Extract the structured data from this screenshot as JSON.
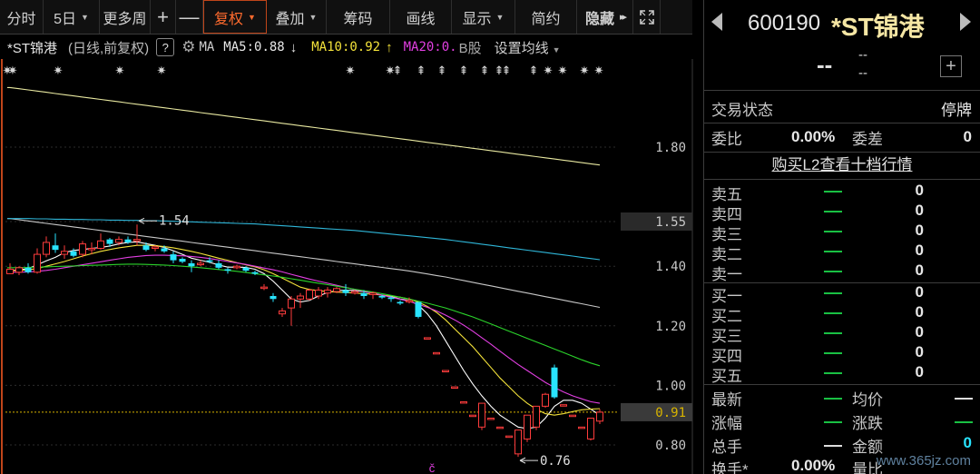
{
  "toolbar": {
    "items": [
      {
        "label": "分时",
        "caret": false
      },
      {
        "label": "5日",
        "caret": true
      },
      {
        "label": "更多周",
        "caret": false
      },
      {
        "label": "+",
        "caret": false
      },
      {
        "label": "—",
        "caret": false
      },
      {
        "label": "复权",
        "caret": true,
        "active": true
      },
      {
        "label": "叠加",
        "caret": true
      },
      {
        "label": "筹码",
        "caret": false
      },
      {
        "label": "画线",
        "caret": false
      },
      {
        "label": "显示",
        "caret": true
      },
      {
        "label": "简约",
        "caret": false
      },
      {
        "label": "隐藏",
        "caret": false
      }
    ],
    "hide_arrows": "▸▸",
    "expand_icon": "expand-icon"
  },
  "ma_line": {
    "stock_name": "*ST锦港",
    "sub": "(日线,前复权)",
    "help": "?",
    "ma_label": "MA",
    "ma5": "MA5:0.88",
    "ma5_arrow": "↓",
    "ma10": "MA10:0.92",
    "ma10_arrow": "↑",
    "ma20": "MA20:0.",
    "b_share": "B股",
    "set_ma": "设置均线"
  },
  "chart_data": {
    "type": "candlestick",
    "y_tick_labels": [
      "1.80",
      "1.55",
      "1.40",
      "1.20",
      "1.00",
      "0.91",
      "0.80"
    ],
    "y_ticks": [
      1.8,
      1.55,
      1.4,
      1.2,
      1.0,
      0.91,
      0.8
    ],
    "current_price_label": "0.91",
    "high_marker": "1.54",
    "low_marker": "0.76",
    "colors": {
      "up": "#ff3c3c",
      "down": "#29e4ff",
      "ma5": "#ffffff",
      "ma10": "#f3e23a",
      "ma20": "#e23fe2",
      "ma30": "#2bd42b",
      "ma60": "#c8c8c8",
      "ma120": "#2fb6d8",
      "ma250": "#e8e8a0",
      "price_line": "#d8b400"
    },
    "candles": [
      {
        "o": 1.375,
        "c": 1.39,
        "h": 1.41,
        "l": 1.375
      },
      {
        "o": 1.38,
        "c": 1.395,
        "h": 1.4,
        "l": 1.37
      },
      {
        "o": 1.395,
        "c": 1.38,
        "h": 1.41,
        "l": 1.375
      },
      {
        "o": 1.38,
        "c": 1.44,
        "h": 1.46,
        "l": 1.375
      },
      {
        "o": 1.44,
        "c": 1.48,
        "h": 1.5,
        "l": 1.43
      },
      {
        "o": 1.47,
        "c": 1.455,
        "h": 1.51,
        "l": 1.445
      },
      {
        "o": 1.44,
        "c": 1.45,
        "h": 1.47,
        "l": 1.425
      },
      {
        "o": 1.45,
        "c": 1.435,
        "h": 1.46,
        "l": 1.43
      },
      {
        "o": 1.44,
        "c": 1.475,
        "h": 1.485,
        "l": 1.43
      },
      {
        "o": 1.46,
        "c": 1.46,
        "h": 1.48,
        "l": 1.44
      },
      {
        "o": 1.46,
        "c": 1.485,
        "h": 1.51,
        "l": 1.455
      },
      {
        "o": 1.49,
        "c": 1.475,
        "h": 1.495,
        "l": 1.465
      },
      {
        "o": 1.48,
        "c": 1.49,
        "h": 1.5,
        "l": 1.47
      },
      {
        "o": 1.49,
        "c": 1.48,
        "h": 1.5,
        "l": 1.475
      },
      {
        "o": 1.485,
        "c": 1.49,
        "h": 1.54,
        "l": 1.47
      },
      {
        "o": 1.47,
        "c": 1.455,
        "h": 1.48,
        "l": 1.45
      },
      {
        "o": 1.46,
        "c": 1.465,
        "h": 1.47,
        "l": 1.45
      },
      {
        "o": 1.46,
        "c": 1.45,
        "h": 1.47,
        "l": 1.445
      },
      {
        "o": 1.44,
        "c": 1.42,
        "h": 1.45,
        "l": 1.41
      },
      {
        "o": 1.425,
        "c": 1.415,
        "h": 1.43,
        "l": 1.41
      },
      {
        "o": 1.41,
        "c": 1.4,
        "h": 1.42,
        "l": 1.38
      },
      {
        "o": 1.405,
        "c": 1.41,
        "h": 1.42,
        "l": 1.4
      },
      {
        "o": 1.42,
        "c": 1.415,
        "h": 1.43,
        "l": 1.41
      },
      {
        "o": 1.41,
        "c": 1.395,
        "h": 1.42,
        "l": 1.39
      },
      {
        "o": 1.39,
        "c": 1.385,
        "h": 1.395,
        "l": 1.375
      },
      {
        "o": 1.395,
        "c": 1.4,
        "h": 1.405,
        "l": 1.39
      },
      {
        "o": 1.395,
        "c": 1.385,
        "h": 1.4,
        "l": 1.38
      },
      {
        "o": 1.38,
        "c": 1.375,
        "h": 1.385,
        "l": 1.37
      },
      {
        "o": 1.33,
        "c": 1.33,
        "h": 1.34,
        "l": 1.32
      },
      {
        "o": 1.3,
        "c": 1.29,
        "h": 1.31,
        "l": 1.28
      },
      {
        "o": 1.24,
        "c": 1.25,
        "h": 1.26,
        "l": 1.23
      },
      {
        "o": 1.26,
        "c": 1.29,
        "h": 1.3,
        "l": 1.2
      },
      {
        "o": 1.29,
        "c": 1.3,
        "h": 1.31,
        "l": 1.26
      },
      {
        "o": 1.29,
        "c": 1.32,
        "h": 1.325,
        "l": 1.285
      },
      {
        "o": 1.3,
        "c": 1.32,
        "h": 1.33,
        "l": 1.29
      },
      {
        "o": 1.31,
        "c": 1.32,
        "h": 1.33,
        "l": 1.295
      },
      {
        "o": 1.315,
        "c": 1.325,
        "h": 1.33,
        "l": 1.31
      },
      {
        "o": 1.32,
        "c": 1.31,
        "h": 1.34,
        "l": 1.3
      },
      {
        "o": 1.31,
        "c": 1.315,
        "h": 1.32,
        "l": 1.305
      },
      {
        "o": 1.31,
        "c": 1.3,
        "h": 1.32,
        "l": 1.29
      },
      {
        "o": 1.305,
        "c": 1.31,
        "h": 1.315,
        "l": 1.29
      },
      {
        "o": 1.3,
        "c": 1.295,
        "h": 1.305,
        "l": 1.29
      },
      {
        "o": 1.295,
        "c": 1.29,
        "h": 1.3,
        "l": 1.28
      },
      {
        "o": 1.28,
        "c": 1.275,
        "h": 1.285,
        "l": 1.27
      },
      {
        "o": 1.285,
        "c": 1.285,
        "h": 1.295,
        "l": 1.275
      },
      {
        "o": 1.28,
        "c": 1.23,
        "h": 1.28,
        "l": 1.225
      },
      {
        "o": 1.16,
        "c": 1.16,
        "h": 1.16,
        "l": 1.16
      },
      {
        "o": 1.11,
        "c": 1.11,
        "h": 1.11,
        "l": 1.11
      },
      {
        "o": 1.05,
        "c": 1.05,
        "h": 1.05,
        "l": 1.05
      },
      {
        "o": 0.995,
        "c": 0.995,
        "h": 0.995,
        "l": 0.995
      },
      {
        "o": 0.945,
        "c": 0.945,
        "h": 0.945,
        "l": 0.945
      },
      {
        "o": 0.9,
        "c": 0.9,
        "h": 0.9,
        "l": 0.9
      },
      {
        "o": 0.86,
        "c": 0.94,
        "h": 0.94,
        "l": 0.85
      },
      {
        "o": 0.89,
        "c": 0.89,
        "h": 0.89,
        "l": 0.89
      },
      {
        "o": 0.86,
        "c": 0.86,
        "h": 0.86,
        "l": 0.86
      },
      {
        "o": 0.83,
        "c": 0.83,
        "h": 0.83,
        "l": 0.83
      },
      {
        "o": 0.77,
        "c": 0.85,
        "h": 0.85,
        "l": 0.76
      },
      {
        "o": 0.82,
        "c": 0.9,
        "h": 0.9,
        "l": 0.81
      },
      {
        "o": 0.86,
        "c": 0.93,
        "h": 0.93,
        "l": 0.85
      },
      {
        "o": 0.93,
        "c": 0.97,
        "h": 0.975,
        "l": 0.925
      },
      {
        "o": 1.06,
        "c": 0.96,
        "h": 1.07,
        "l": 0.955
      },
      {
        "o": 0.935,
        "c": 0.935,
        "h": 0.935,
        "l": 0.935
      },
      {
        "o": 0.9,
        "c": 0.9,
        "h": 0.9,
        "l": 0.9
      },
      {
        "o": 0.86,
        "c": 0.86,
        "h": 0.86,
        "l": 0.86
      },
      {
        "o": 0.82,
        "c": 0.89,
        "h": 0.89,
        "l": 0.815
      },
      {
        "o": 0.88,
        "c": 0.91,
        "h": 0.92,
        "l": 0.87
      }
    ],
    "ma_lines": {
      "ma5": [
        1.385,
        1.388,
        1.392,
        1.405,
        1.418,
        1.43,
        1.446,
        1.453,
        1.456,
        1.46,
        1.463,
        1.468,
        1.475,
        1.48,
        1.482,
        1.476,
        1.47,
        1.463,
        1.452,
        1.44,
        1.427,
        1.42,
        1.413,
        1.404,
        1.397,
        1.397,
        1.396,
        1.39,
        1.375,
        1.35,
        1.32,
        1.29,
        1.28,
        1.285,
        1.3,
        1.312,
        1.318,
        1.32,
        1.318,
        1.315,
        1.309,
        1.302,
        1.298,
        1.29,
        1.285,
        1.27,
        1.24,
        1.2,
        1.15,
        1.1,
        1.05,
        1.005,
        0.965,
        0.93,
        0.9,
        0.88,
        0.86,
        0.855,
        0.86,
        0.89,
        0.93,
        0.95,
        0.95,
        0.94,
        0.92,
        0.9
      ],
      "ma10": [
        1.385,
        1.386,
        1.388,
        1.392,
        1.4,
        1.408,
        1.416,
        1.425,
        1.434,
        1.442,
        1.45,
        1.456,
        1.462,
        1.466,
        1.47,
        1.47,
        1.469,
        1.466,
        1.462,
        1.456,
        1.45,
        1.443,
        1.435,
        1.427,
        1.42,
        1.412,
        1.405,
        1.398,
        1.388,
        1.375,
        1.36,
        1.345,
        1.33,
        1.322,
        1.318,
        1.315,
        1.313,
        1.312,
        1.31,
        1.308,
        1.306,
        1.303,
        1.3,
        1.296,
        1.29,
        1.28,
        1.265,
        1.245,
        1.22,
        1.19,
        1.16,
        1.13,
        1.095,
        1.06,
        1.025,
        0.995,
        0.965,
        0.94,
        0.92,
        0.905,
        0.9,
        0.905,
        0.912,
        0.918,
        0.92,
        0.922
      ],
      "ma20": [
        1.38,
        1.38,
        1.381,
        1.383,
        1.386,
        1.39,
        1.395,
        1.4,
        1.405,
        1.41,
        1.415,
        1.42,
        1.425,
        1.43,
        1.433,
        1.436,
        1.437,
        1.437,
        1.436,
        1.435,
        1.433,
        1.43,
        1.426,
        1.421,
        1.416,
        1.411,
        1.406,
        1.4,
        1.394,
        1.388,
        1.381,
        1.373,
        1.365,
        1.357,
        1.35,
        1.343,
        1.336,
        1.329,
        1.322,
        1.316,
        1.31,
        1.303,
        1.296,
        1.289,
        1.282,
        1.272,
        1.262,
        1.25,
        1.236,
        1.22,
        1.202,
        1.182,
        1.16,
        1.138,
        1.115,
        1.092,
        1.07,
        1.05,
        1.03,
        1.01,
        0.993,
        0.978,
        0.965,
        0.955,
        0.945,
        0.94
      ],
      "ma30": [
        1.395,
        1.395,
        1.396,
        1.397,
        1.398,
        1.399,
        1.4,
        1.401,
        1.402,
        1.403,
        1.404,
        1.405,
        1.406,
        1.407,
        1.407,
        1.406,
        1.405,
        1.404,
        1.402,
        1.4,
        1.398,
        1.395,
        1.392,
        1.389,
        1.386,
        1.383,
        1.379,
        1.375,
        1.371,
        1.367,
        1.363,
        1.358,
        1.353,
        1.348,
        1.343,
        1.338,
        1.333,
        1.328,
        1.323,
        1.318,
        1.313,
        1.308,
        1.302,
        1.296,
        1.29,
        1.283,
        1.276,
        1.268,
        1.26,
        1.25,
        1.24,
        1.23,
        1.218,
        1.206,
        1.194,
        1.182,
        1.17,
        1.158,
        1.146,
        1.134,
        1.122,
        1.11,
        1.098,
        1.086,
        1.075,
        1.066
      ],
      "ma60": [
        1.56,
        1.556,
        1.552,
        1.548,
        1.544,
        1.54,
        1.536,
        1.532,
        1.528,
        1.524,
        1.52,
        1.516,
        1.512,
        1.508,
        1.504,
        1.5,
        1.496,
        1.492,
        1.488,
        1.484,
        1.48,
        1.476,
        1.472,
        1.468,
        1.464,
        1.46,
        1.456,
        1.452,
        1.448,
        1.444,
        1.44,
        1.436,
        1.432,
        1.428,
        1.424,
        1.42,
        1.416,
        1.412,
        1.408,
        1.404,
        1.4,
        1.396,
        1.392,
        1.388,
        1.384,
        1.379,
        1.374,
        1.369,
        1.364,
        1.358,
        1.352,
        1.346,
        1.34,
        1.334,
        1.328,
        1.322,
        1.316,
        1.31,
        1.304,
        1.298,
        1.292,
        1.286,
        1.28,
        1.274,
        1.268,
        1.262
      ],
      "ma120": [
        1.56,
        1.56,
        1.56,
        1.559,
        1.559,
        1.558,
        1.558,
        1.557,
        1.557,
        1.556,
        1.556,
        1.555,
        1.555,
        1.554,
        1.554,
        1.553,
        1.553,
        1.552,
        1.551,
        1.55,
        1.549,
        1.548,
        1.547,
        1.546,
        1.545,
        1.544,
        1.543,
        1.542,
        1.54,
        1.538,
        1.536,
        1.534,
        1.532,
        1.53,
        1.528,
        1.526,
        1.524,
        1.522,
        1.52,
        1.517,
        1.514,
        1.511,
        1.508,
        1.505,
        1.502,
        1.499,
        1.496,
        1.493,
        1.49,
        1.486,
        1.482,
        1.478,
        1.474,
        1.47,
        1.466,
        1.462,
        1.458,
        1.454,
        1.45,
        1.446,
        1.442,
        1.438,
        1.434,
        1.43,
        1.426,
        1.422
      ],
      "ma250": [
        2.0,
        1.996,
        1.992,
        1.988,
        1.984,
        1.98,
        1.976,
        1.972,
        1.968,
        1.964,
        1.96,
        1.956,
        1.952,
        1.948,
        1.944,
        1.94,
        1.936,
        1.932,
        1.928,
        1.924,
        1.92,
        1.916,
        1.912,
        1.908,
        1.904,
        1.9,
        1.896,
        1.892,
        1.888,
        1.884,
        1.88,
        1.876,
        1.872,
        1.868,
        1.864,
        1.86,
        1.856,
        1.852,
        1.848,
        1.844,
        1.84,
        1.836,
        1.832,
        1.828,
        1.824,
        1.82,
        1.816,
        1.812,
        1.808,
        1.804,
        1.8,
        1.796,
        1.792,
        1.788,
        1.784,
        1.78,
        1.776,
        1.772,
        1.768,
        1.764,
        1.76,
        1.756,
        1.752,
        1.748,
        1.744,
        1.74
      ]
    },
    "current_price": 0.91
  },
  "panel": {
    "code": "600190",
    "name": "*ST锦港",
    "price": "--",
    "change": "--",
    "change_pct": "--",
    "plus": "+",
    "status_label": "交易状态",
    "status_value": "停牌",
    "weibi_label": "委比",
    "weibi_value": "0.00%",
    "weicha_label": "委差",
    "weicha_value": "0",
    "l2_link": "购买L2查看十档行情",
    "sell": [
      {
        "label": "卖五",
        "vol": "0"
      },
      {
        "label": "卖四",
        "vol": "0"
      },
      {
        "label": "卖三",
        "vol": "0"
      },
      {
        "label": "卖二",
        "vol": "0"
      },
      {
        "label": "卖一",
        "vol": "0"
      }
    ],
    "buy": [
      {
        "label": "买一",
        "vol": "0"
      },
      {
        "label": "买二",
        "vol": "0"
      },
      {
        "label": "买三",
        "vol": "0"
      },
      {
        "label": "买四",
        "vol": "0"
      },
      {
        "label": "买五",
        "vol": "0"
      }
    ],
    "stats": {
      "zuixin": "最新",
      "junjia": "均价",
      "zhangfu": "涨幅",
      "zhangdie": "涨跌",
      "zongshou": "总手",
      "jine": "金额",
      "jine_value": "0",
      "huanshou": "换手*",
      "huanshou_value": "0.00%",
      "liangbi": "量比"
    }
  },
  "watermark": "www.365jz.com"
}
